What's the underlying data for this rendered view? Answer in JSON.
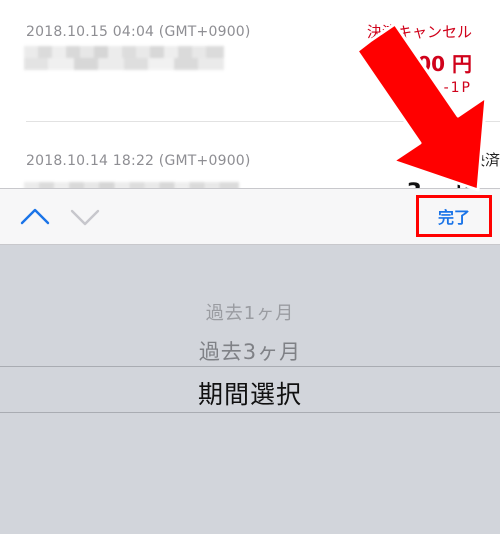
{
  "transactions": [
    {
      "datetime": "2018.10.15 04:04 (GMT+0900)",
      "status": "決済キャンセル",
      "amount": "300 円",
      "points": "-1P"
    },
    {
      "datetime": "2018.10.14 18:22 (GMT+0900)",
      "status_partial": "決済",
      "amount_partial": "3",
      "amount_unit_partial": "円"
    }
  ],
  "toolbar": {
    "prev_icon": "chevron-up-icon",
    "next_icon": "chevron-down-icon",
    "done_label": "完了"
  },
  "picker": {
    "options": [
      "過去1ヶ月",
      "過去3ヶ月",
      "期間選択"
    ],
    "selected": "期間選択"
  },
  "colors": {
    "accent_red": "#d0021b",
    "ios_blue": "#1a74e8",
    "annotation_red": "#ff0000",
    "picker_bg": "#d2d5db",
    "toolbar_bg": "#f7f7f8"
  }
}
